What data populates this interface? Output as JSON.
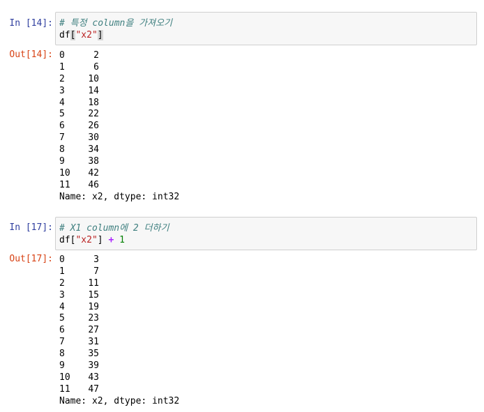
{
  "cells": [
    {
      "in_prompt": "In [14]:",
      "comment": "# 특정 column을 가져오기",
      "code": {
        "df": "df",
        "bracket_open": "[",
        "string": "\"x2\"",
        "bracket_close": "]",
        "op": "",
        "num": ""
      },
      "out_prompt": "Out[14]:",
      "rows": [
        {
          "index": "0",
          "value": "2"
        },
        {
          "index": "1",
          "value": "6"
        },
        {
          "index": "2",
          "value": "10"
        },
        {
          "index": "3",
          "value": "14"
        },
        {
          "index": "4",
          "value": "18"
        },
        {
          "index": "5",
          "value": "22"
        },
        {
          "index": "6",
          "value": "26"
        },
        {
          "index": "7",
          "value": "30"
        },
        {
          "index": "8",
          "value": "34"
        },
        {
          "index": "9",
          "value": "38"
        },
        {
          "index": "10",
          "value": "42"
        },
        {
          "index": "11",
          "value": "46"
        }
      ],
      "footer": "Name: x2, dtype: int32"
    },
    {
      "in_prompt": "In [17]:",
      "comment": "# X1 column에 2 더하기",
      "code": {
        "df": "df",
        "bracket_open": "[",
        "string": "\"x2\"",
        "bracket_close": "]",
        "op": "+",
        "num": "1"
      },
      "out_prompt": "Out[17]:",
      "rows": [
        {
          "index": "0",
          "value": "3"
        },
        {
          "index": "1",
          "value": "7"
        },
        {
          "index": "2",
          "value": "11"
        },
        {
          "index": "3",
          "value": "15"
        },
        {
          "index": "4",
          "value": "19"
        },
        {
          "index": "5",
          "value": "23"
        },
        {
          "index": "6",
          "value": "27"
        },
        {
          "index": "7",
          "value": "31"
        },
        {
          "index": "8",
          "value": "35"
        },
        {
          "index": "9",
          "value": "39"
        },
        {
          "index": "10",
          "value": "43"
        },
        {
          "index": "11",
          "value": "47"
        }
      ],
      "footer": "Name: x2, dtype: int32"
    }
  ]
}
